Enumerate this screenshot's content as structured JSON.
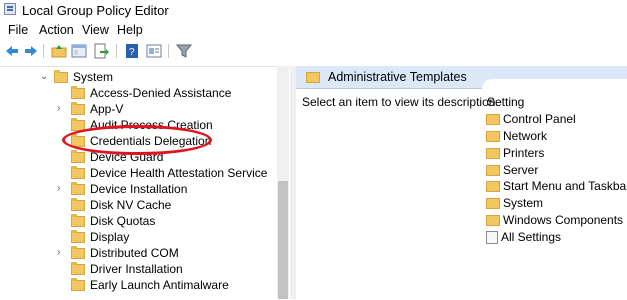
{
  "window": {
    "title": "Local Group Policy Editor"
  },
  "menu": [
    "File",
    "Action",
    "View",
    "Help"
  ],
  "toolbar": {
    "icons": [
      "back-icon",
      "forward-icon",
      "up-folder-icon",
      "show-hide-tree-icon",
      "export-list-icon",
      "help-icon",
      "properties-icon",
      "filter-icon"
    ]
  },
  "tree": {
    "items": [
      {
        "label": "System",
        "expander": "down"
      },
      {
        "label": "Access-Denied Assistance",
        "expander": ""
      },
      {
        "label": "App-V",
        "expander": "right"
      },
      {
        "label": "Audit Process Creation",
        "expander": ""
      },
      {
        "label": "Credentials Delegation",
        "expander": ""
      },
      {
        "label": "Device Guard",
        "expander": ""
      },
      {
        "label": "Device Health Attestation Service",
        "expander": ""
      },
      {
        "label": "Device Installation",
        "expander": "right"
      },
      {
        "label": "Disk NV Cache",
        "expander": ""
      },
      {
        "label": "Disk Quotas",
        "expander": ""
      },
      {
        "label": "Display",
        "expander": ""
      },
      {
        "label": "Distributed COM",
        "expander": "right"
      },
      {
        "label": "Driver Installation",
        "expander": ""
      },
      {
        "label": "Early Launch Antimalware",
        "expander": ""
      }
    ]
  },
  "right": {
    "header": "Administrative Templates",
    "description": "Select an item to view its description.",
    "setting_header": "Setting",
    "settings": [
      "Control Panel",
      "Network",
      "Printers",
      "Server",
      "Start Menu and Taskbar",
      "System",
      "Windows Components"
    ],
    "all_settings": "All Settings"
  },
  "colors": {
    "highlight_ellipse": "#e0141e",
    "folder": "#f2c661",
    "header_bg": "#dce8f7"
  }
}
